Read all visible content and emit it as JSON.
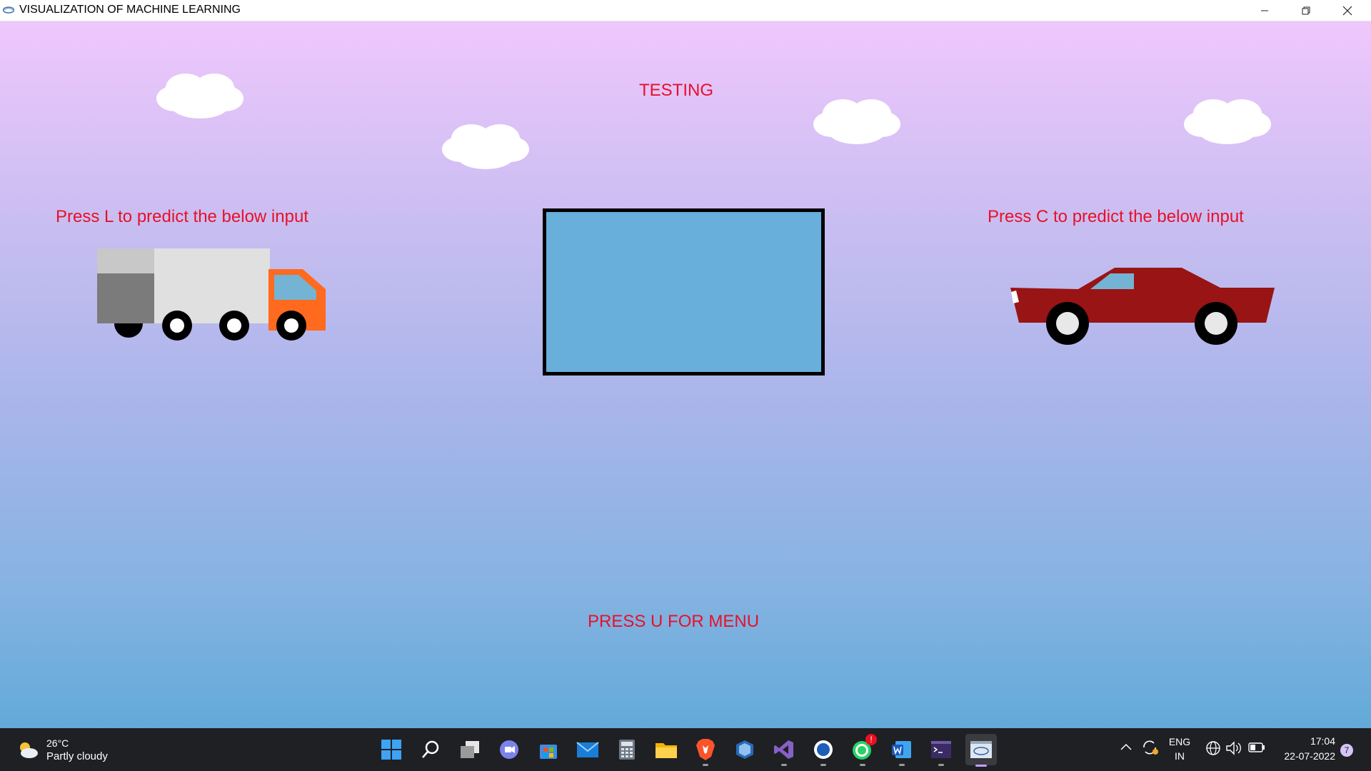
{
  "window": {
    "title": "VISUALIZATION OF MACHINE LEARNING",
    "controls": [
      "minimize",
      "restore",
      "close"
    ]
  },
  "scene": {
    "heading": "TESTING",
    "left_hint": "Press L to predict the below input",
    "right_hint": "Press C to predict the below input",
    "menu_hint": "PRESS U FOR MENU",
    "text_color": "#e8102a",
    "input_box_color": "#68afdb"
  },
  "taskbar": {
    "weather": {
      "temp": "26°C",
      "condition": "Partly cloudy",
      "icon": "partly-cloudy-icon"
    },
    "apps": [
      {
        "name": "start-icon"
      },
      {
        "name": "search-icon"
      },
      {
        "name": "task-view-icon"
      },
      {
        "name": "teams-chat-icon"
      },
      {
        "name": "store-icon"
      },
      {
        "name": "mail-icon"
      },
      {
        "name": "calculator-icon"
      },
      {
        "name": "file-explorer-icon"
      },
      {
        "name": "brave-browser-icon"
      },
      {
        "name": "virtualbox-icon"
      },
      {
        "name": "visual-studio-icon"
      },
      {
        "name": "app-w-icon"
      },
      {
        "name": "whatsapp-icon",
        "badge": "!"
      },
      {
        "name": "word-icon"
      },
      {
        "name": "terminal-icon"
      },
      {
        "name": "opengl-app-icon"
      }
    ],
    "tray": {
      "language_top": "ENG",
      "language_bottom": "IN",
      "time": "17:04",
      "date": "22-07-2022",
      "notification_count": "7"
    }
  }
}
